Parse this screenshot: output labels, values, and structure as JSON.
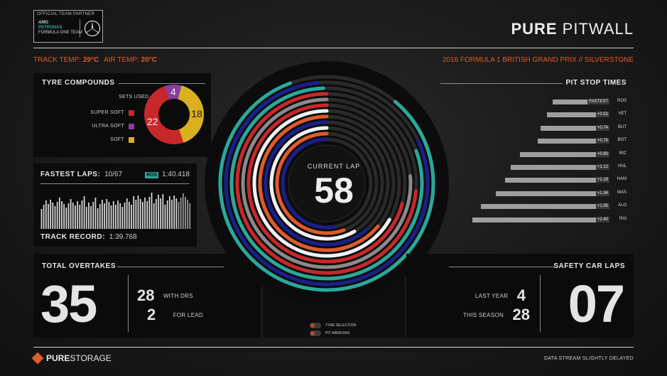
{
  "header": {
    "partner_label": "OFFICIAL TEAM PARTNER",
    "team_line1": "AMG",
    "team_line2": "PETRONAS",
    "team_line3": "FORMULA ONE TEAM",
    "title_bold": "PURE",
    "title_light": " PITWALL",
    "track_temp_label": "TRACK TEMP:",
    "track_temp_value": "29°C",
    "air_temp_label": "AIR TEMP:",
    "air_temp_value": "20°C",
    "race_name": "2016 FORMULA 1 BRITISH GRAND PRIX // SILVERSTONE"
  },
  "tyres": {
    "title": "TYRE COMPOUNDS",
    "subtitle": "SETS USED",
    "items": [
      {
        "label": "SUPER SOFT",
        "value": 22,
        "color": "#c8282a"
      },
      {
        "label": "ULTRA SOFT",
        "value": 4,
        "color": "#8a3ca0"
      },
      {
        "label": "SOFT",
        "value": 18,
        "color": "#d9b020"
      }
    ]
  },
  "fastest": {
    "title": "FASTEST LAPS:",
    "count": "10/67",
    "driver": "ROS",
    "time": "1:40.418",
    "record_label": "TRACK RECORD:",
    "record_value": "1:39.768"
  },
  "overtakes": {
    "title": "TOTAL OVERTAKES",
    "total": "35",
    "drs_value": "28",
    "drs_label": "WITH DRS",
    "lead_value": "2",
    "lead_label": "FOR LEAD"
  },
  "center": {
    "label": "CURRENT LAP",
    "lap": "58",
    "toggle1": "TYRE SELECTION",
    "toggle2": "PIT WINDOWS"
  },
  "pitstops": {
    "title": "PIT STOP TIMES",
    "rows": [
      {
        "driver": "ROS",
        "delta": "FASTEST",
        "fraction": 0.38
      },
      {
        "driver": "VET",
        "delta": "+0.51",
        "fraction": 0.42
      },
      {
        "driver": "BUT",
        "delta": "+0.74",
        "fraction": 0.46
      },
      {
        "driver": "BOT",
        "delta": "+0.78",
        "fraction": 0.48
      },
      {
        "driver": "RIC",
        "delta": "+0.80",
        "fraction": 0.6
      },
      {
        "driver": "HUL",
        "delta": "+1.12",
        "fraction": 0.66
      },
      {
        "driver": "HAM",
        "delta": "+1.19",
        "fraction": 0.7
      },
      {
        "driver": "MAS",
        "delta": "+1.34",
        "fraction": 0.76
      },
      {
        "driver": "ALO",
        "delta": "+1.95",
        "fraction": 0.86
      },
      {
        "driver": "RAI",
        "delta": "+2.40",
        "fraction": 0.92
      }
    ]
  },
  "safety": {
    "title": "SAFETY CAR LAPS",
    "total": "07",
    "last_value": "4",
    "last_label": "LAST YEAR",
    "season_value": "28",
    "season_label": "THIS SEASON"
  },
  "footer": {
    "brand_bold": "PURE",
    "brand_light": "STORAGE",
    "note": "DATA STREAM SLIGHTLY DELAYED"
  },
  "colors": {
    "accent": "#e05a2a",
    "teal": "#2aa89a",
    "navy": "#1a1f8a",
    "red": "#c8282a"
  }
}
